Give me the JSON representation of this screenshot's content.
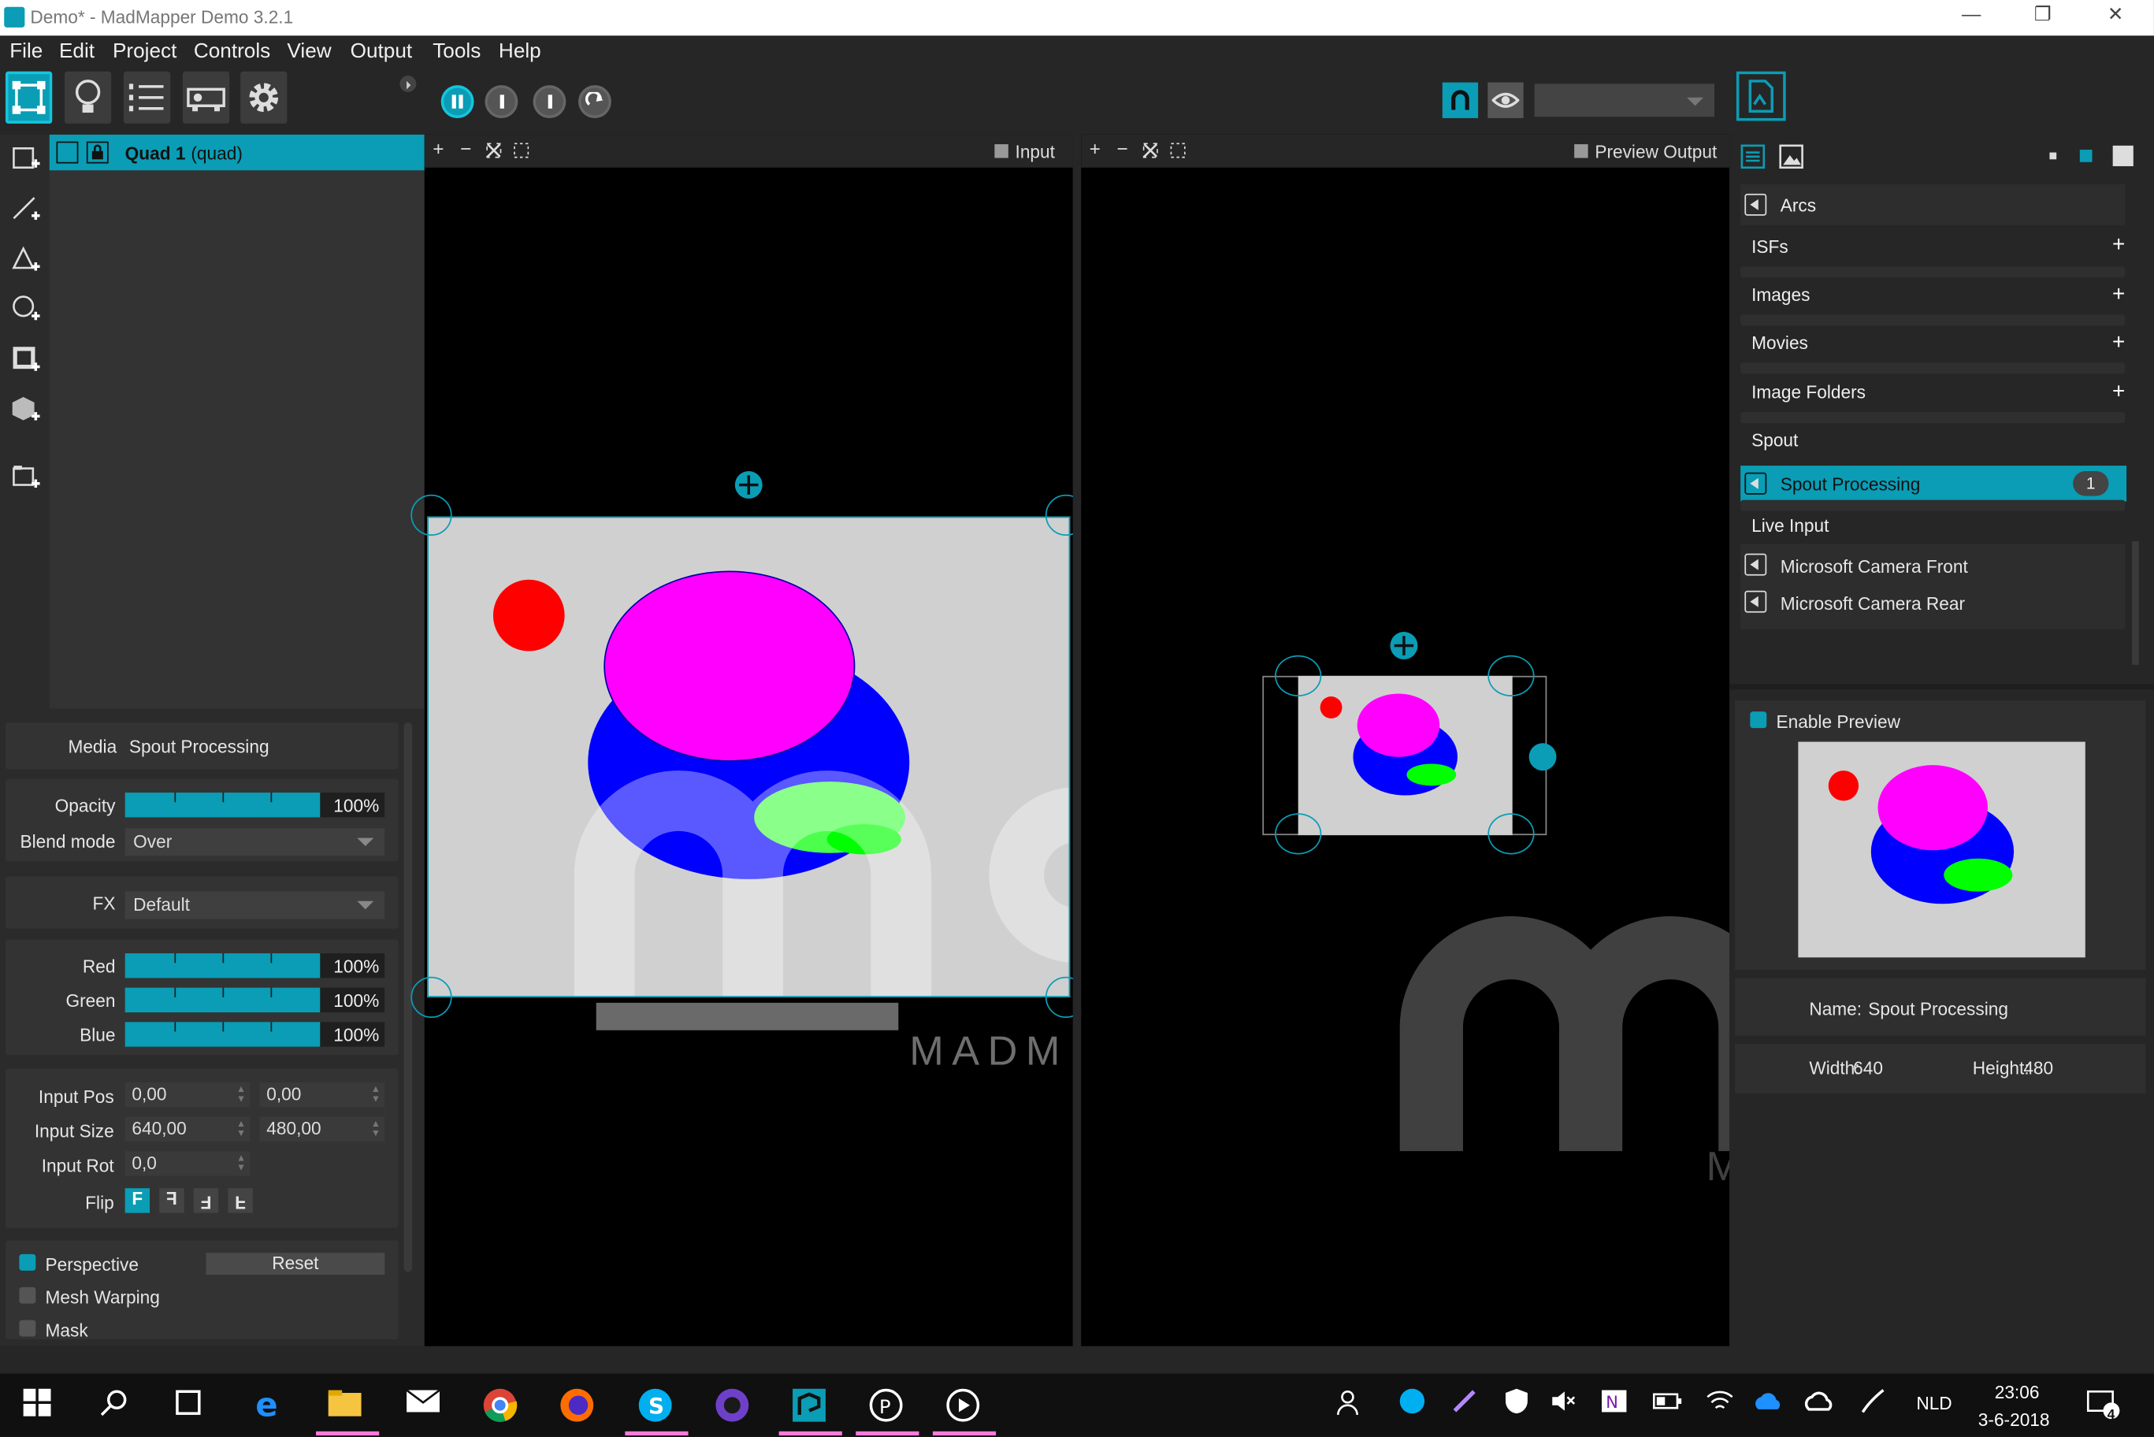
{
  "window": {
    "title": "Demo* - MadMapper Demo 3.2.1",
    "minimize": "—",
    "restore": "❐",
    "close": "✕"
  },
  "menu": [
    "File",
    "Edit",
    "Project",
    "Controls",
    "View",
    "Output",
    "Tools",
    "Help"
  ],
  "toolbar": {
    "preview_combo_value": ""
  },
  "layers": [
    {
      "name": "Quad 1",
      "type": "(quad)"
    }
  ],
  "properties": {
    "media_label": "Media",
    "media_value": "Spout Processing",
    "opacity_label": "Opacity",
    "opacity_value": "100%",
    "opacity_fraction": 1.0,
    "blend_label": "Blend mode",
    "blend_value": "Over",
    "fx_label": "FX",
    "fx_value": "Default",
    "red_label": "Red",
    "red_value": "100%",
    "green_label": "Green",
    "green_value": "100%",
    "blue_label": "Blue",
    "blue_value": "100%",
    "input_pos_label": "Input Pos",
    "input_pos_x": "0,00",
    "input_pos_y": "0,00",
    "input_size_label": "Input Size",
    "input_size_w": "640,00",
    "input_size_h": "480,00",
    "input_rot_label": "Input Rot",
    "input_rot": "0,0",
    "flip_label": "Flip",
    "flip_buttons": [
      "F",
      "F",
      "F",
      "F"
    ],
    "perspective_label": "Perspective",
    "perspective_checked": true,
    "reset_label": "Reset",
    "mesh_warping_label": "Mesh Warping",
    "mesh_warping_checked": false,
    "mask_label": "Mask",
    "mask_checked": false
  },
  "input_view": {
    "label": "Input",
    "zoom_in": "+",
    "zoom_out": "−",
    "watermark": "MADM"
  },
  "output_view": {
    "label": "Preview Output",
    "zoom_in": "+",
    "zoom_out": "−",
    "watermark": "M"
  },
  "library": {
    "arcs": "Arcs",
    "isfs": "ISFs",
    "images": "Images",
    "movies": "Movies",
    "image_folders": "Image Folders",
    "spout": "Spout",
    "spout_item": "Spout Processing",
    "spout_count": "1",
    "live_input": "Live Input",
    "cam_front": "Microsoft Camera Front",
    "cam_rear": "Microsoft Camera Rear",
    "plus": "+"
  },
  "preview": {
    "enable_label": "Enable Preview",
    "enabled": true,
    "name_label": "Name:",
    "name_value": "Spout Processing",
    "width_label": "Width:",
    "width_value": "640",
    "height_label": "Height:",
    "height_value": "480"
  },
  "taskbar": {
    "language": "NLD",
    "time": "23:06",
    "date": "3-6-2018",
    "notifications": "4"
  },
  "colors": {
    "accent": "#0a9db5",
    "red": "#ff0000",
    "magenta": "#ff00ff",
    "blue": "#0000ff",
    "green": "#4cff4c",
    "canvas_bg": "#d0d0d0"
  }
}
